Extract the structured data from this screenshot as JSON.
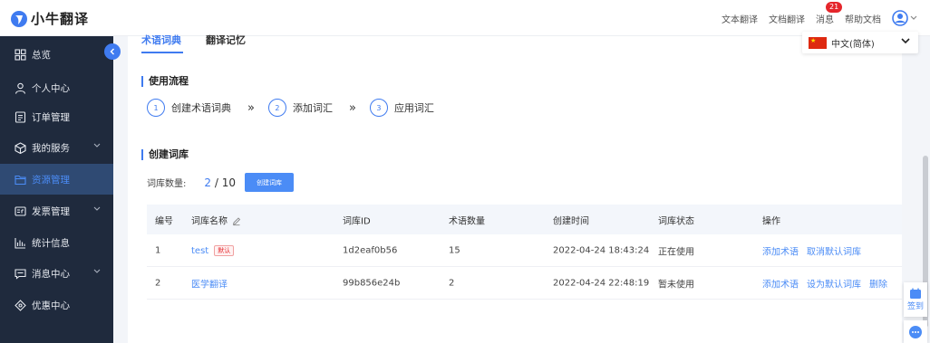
{
  "brand": {
    "name": "小牛翻译"
  },
  "topnav": {
    "text_translate": "文本翻译",
    "doc_translate": "文档翻译",
    "messages": "消息",
    "message_count": "21",
    "help_docs": "帮助文档"
  },
  "sidebar": {
    "items": [
      {
        "label": "总览",
        "icon": "grid-icon"
      },
      {
        "label": "个人中心",
        "icon": "user-icon"
      },
      {
        "label": "订单管理",
        "icon": "order-icon"
      },
      {
        "label": "我的服务",
        "icon": "cube-icon"
      },
      {
        "label": "资源管理",
        "icon": "folder-icon"
      },
      {
        "label": "发票管理",
        "icon": "invoice-icon"
      },
      {
        "label": "统计信息",
        "icon": "chart-icon"
      },
      {
        "label": "消息中心",
        "icon": "message-icon"
      },
      {
        "label": "优惠中心",
        "icon": "coupon-icon"
      }
    ],
    "active": "资源管理"
  },
  "tabs": [
    {
      "label": "术语词典"
    },
    {
      "label": "翻译记忆"
    }
  ],
  "language": {
    "selected": "中文(简体)"
  },
  "workflow": {
    "title": "使用流程",
    "steps": [
      {
        "num": "1",
        "label": "创建术语词典"
      },
      {
        "num": "2",
        "label": "添加词汇"
      },
      {
        "num": "3",
        "label": "应用词汇"
      }
    ]
  },
  "library": {
    "title": "创建词库",
    "count_label": "词库数量:",
    "count_current": "2",
    "count_total": "/ 10",
    "create_button": "创建词库"
  },
  "table": {
    "headers": [
      "编号",
      "词库名称",
      "词库ID",
      "术语数量",
      "创建时间",
      "词库状态",
      "操作"
    ],
    "rows": [
      {
        "num": "1",
        "name": "test",
        "tag": "默认",
        "id": "1d2eaf0b56",
        "terms": "15",
        "created": "2022-04-24 18:43:24",
        "status": "正在使用",
        "ops": [
          "添加术语",
          "取消默认词库"
        ]
      },
      {
        "num": "2",
        "name": "医学翻译",
        "tag": "",
        "id": "99b856e24b",
        "terms": "2",
        "created": "2022-04-24 22:48:19",
        "status": "暂未使用",
        "ops": [
          "添加术语",
          "设为默认词库",
          "删除"
        ]
      }
    ]
  },
  "float": {
    "checkin": "签到"
  },
  "colors": {
    "accent": "#3f7bf0",
    "sidebar_bg": "#1f2a3d",
    "badge": "#e5262b"
  }
}
